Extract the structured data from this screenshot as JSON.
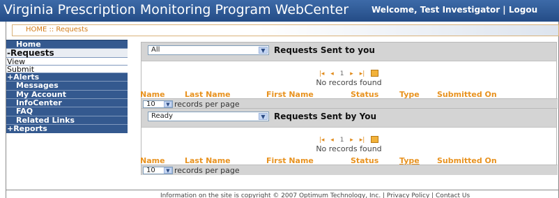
{
  "header": {
    "title": "Virginia Prescription Monitoring Program WebCenter",
    "welcome": "Welcome, Test Investigator | Logou"
  },
  "breadcrumb": "HOME :: Requests",
  "sidebar": {
    "items": [
      {
        "label": "Home"
      },
      {
        "label": "-Requests"
      },
      {
        "label": "View"
      },
      {
        "label": "Submit"
      },
      {
        "label": "+Alerts"
      },
      {
        "label": "Messages"
      },
      {
        "label": "My Account"
      },
      {
        "label": "InfoCenter"
      },
      {
        "label": "FAQ"
      },
      {
        "label": "Related Links"
      },
      {
        "label": "+Reports"
      }
    ]
  },
  "panels": [
    {
      "filter_value": "All",
      "title": "Requests Sent to you",
      "pager": {
        "first": "|◂",
        "prev": "◂",
        "page": "1",
        "next": "▸",
        "last": "▸|"
      },
      "no_records": "No records found",
      "columns": [
        "Name",
        "Last Name",
        "First Name",
        "Status",
        "Type",
        "Submitted On"
      ],
      "per_page_value": "10",
      "per_page_label": "records per page"
    },
    {
      "filter_value": "Ready",
      "title": "Requests Sent by You",
      "pager": {
        "first": "|◂",
        "prev": "◂",
        "page": "1",
        "next": "▸",
        "last": "▸|"
      },
      "no_records": "No records found",
      "columns": [
        "Name",
        "Last Name",
        "First Name",
        "Status",
        "Type",
        "Submitted On"
      ],
      "per_page_value": "10",
      "per_page_label": "records per page"
    }
  ],
  "footer": "Information on the site is copyright © 2007 Optimum Technology, Inc. | Privacy Policy | Contact Us",
  "colors": {
    "header_blue": "#2e5a96",
    "nav_blue": "#34598f",
    "accent_orange": "#e8921f"
  }
}
